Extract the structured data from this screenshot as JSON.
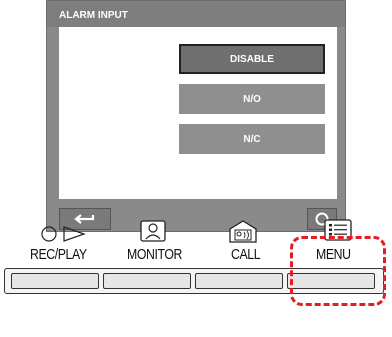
{
  "screen": {
    "title": "ALARM INPUT",
    "options": [
      "DISABLE",
      "N/O",
      "N/C"
    ],
    "selected_option": "DISABLE"
  },
  "softkeys": {
    "back": "back-arrow-icon",
    "ok": "circle-icon"
  },
  "buttons": {
    "rec_play": "REC/PLAY",
    "monitor": "MONITOR",
    "call": "CALL",
    "menu": "MENU"
  },
  "colors": {
    "screen_bg": "#8a8a8a",
    "button_bg": "#8f8f8f",
    "highlight": "#e41c24"
  }
}
